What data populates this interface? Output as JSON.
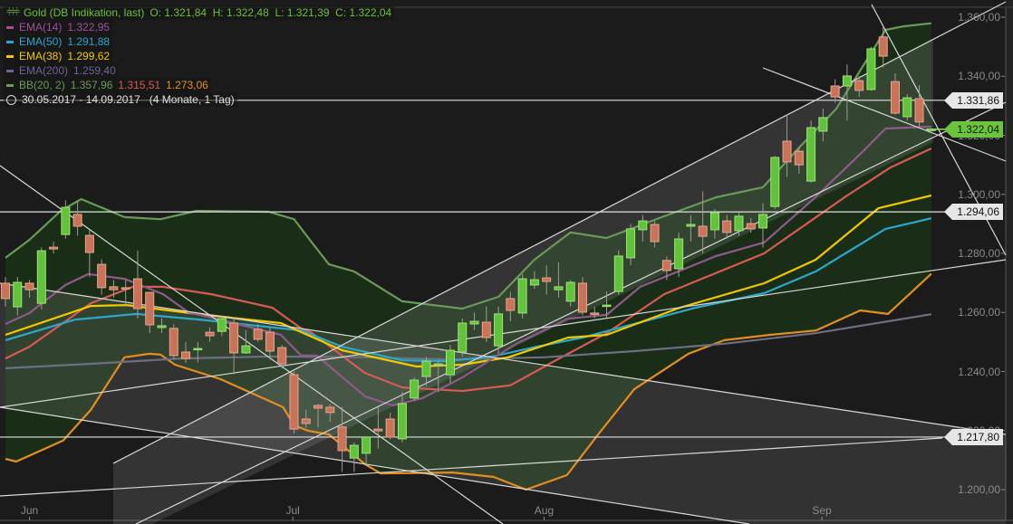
{
  "legend": {
    "title": "Gold (DB Indikation, last)",
    "ohlc": "O: 1.321,84  H: 1.322,48  L: 1.321,39  C: 1.322,04",
    "ema14": {
      "label": "EMA(14)",
      "value": "1.322,95",
      "color": "#a0509a"
    },
    "ema50": {
      "label": "EMA(50)",
      "value": "1.291,88",
      "color": "#2ba7cc"
    },
    "ema38": {
      "label": "EMA(38)",
      "value": "1.299,62",
      "color": "#f2c800"
    },
    "ema200": {
      "label": "EMA(200)",
      "value": "1.259,40",
      "color": "#6b6594"
    },
    "bb": {
      "label": "BB(20, 2)",
      "upper": "1.357,96",
      "mid": "1.315,51",
      "lower": "1.273,06",
      "upper_color": "#6a9a58",
      "mid_color": "#d85a55",
      "lower_color": "#e48e22"
    },
    "range": "30.05.2017 - 14.09.2017   (4 Monate, 1 Tag)",
    "title_color": "#6cbf3c"
  },
  "price_tags": [
    {
      "value": 1331.86,
      "label": "1.331,86",
      "type": "line"
    },
    {
      "value": 1322.04,
      "label": "1.322,04",
      "type": "last"
    },
    {
      "value": 1294.06,
      "label": "1.294,06",
      "type": "line"
    },
    {
      "value": 1217.8,
      "label": "1.217,80",
      "type": "line"
    }
  ],
  "chart_data": {
    "type": "candlestick",
    "title": "Gold (DB Indikation, last)",
    "ylim": [
      1200,
      1360
    ],
    "y_ticks": [
      {
        "value": 1360,
        "label": "1.360,00"
      },
      {
        "value": 1340,
        "label": "1.340,00"
      },
      {
        "value": 1320,
        "label": "1.320,00"
      },
      {
        "value": 1300,
        "label": "1.300,00"
      },
      {
        "value": 1280,
        "label": "1.280,00"
      },
      {
        "value": 1260,
        "label": "1.260,00"
      },
      {
        "value": 1240,
        "label": "1.240,00"
      },
      {
        "value": 1220,
        "label": "1.220,00"
      },
      {
        "value": 1200,
        "label": "1.200,00"
      }
    ],
    "x_ticks": [
      {
        "label": "Jun",
        "index": 2.0
      },
      {
        "label": "Jul",
        "index": 23.9
      },
      {
        "label": "Aug",
        "index": 44.8
      },
      {
        "label": "Sep",
        "index": 67.9
      }
    ],
    "candles_ohlc": [
      [
        1269.9,
        1272,
        1262,
        1264.7
      ],
      [
        1261.9,
        1272,
        1259,
        1270.2
      ],
      [
        1269.9,
        1271,
        1265,
        1267.7
      ],
      [
        1263.1,
        1282,
        1261,
        1280.9
      ],
      [
        1282.1,
        1284,
        1280,
        1281.5
      ],
      [
        1286.4,
        1298,
        1285,
        1295.6
      ],
      [
        1293.2,
        1298,
        1286,
        1289.2
      ],
      [
        1286.1,
        1288,
        1272,
        1280.3
      ],
      [
        1276.3,
        1278,
        1266,
        1268.4
      ],
      [
        1268.7,
        1271,
        1265,
        1267.7
      ],
      [
        1268.4,
        1271,
        1262,
        1268.0
      ],
      [
        1271.4,
        1281,
        1258,
        1261.3
      ],
      [
        1266.8,
        1267,
        1253,
        1255.8
      ],
      [
        1254.9,
        1258,
        1253,
        1255.5
      ],
      [
        1254.6,
        1256,
        1244,
        1245.4
      ],
      [
        1246.6,
        1250,
        1243,
        1244.4
      ],
      [
        1247.5,
        1250,
        1243,
        1247.8
      ],
      [
        1253.3,
        1255,
        1250,
        1252.1
      ],
      [
        1253.6,
        1259,
        1252,
        1257.9
      ],
      [
        1256.4,
        1258,
        1239,
        1246.3
      ],
      [
        1246.3,
        1254,
        1246,
        1248.7
      ],
      [
        1254.3,
        1256,
        1250,
        1250.9
      ],
      [
        1253.3,
        1255,
        1244,
        1246.9
      ],
      [
        1248.1,
        1249,
        1241,
        1242.6
      ],
      [
        1238.9,
        1240,
        1219,
        1220.5
      ],
      [
        1223.9,
        1227,
        1221,
        1222.4
      ],
      [
        1228.5,
        1229,
        1221,
        1227.6
      ],
      [
        1227.9,
        1229,
        1223,
        1226.1
      ],
      [
        1221.2,
        1228,
        1206,
        1213.2
      ],
      [
        1210.7,
        1216,
        1206,
        1215.0
      ],
      [
        1212.3,
        1218,
        1208,
        1217.8
      ],
      [
        1220.5,
        1228,
        1214,
        1219.9
      ],
      [
        1223.9,
        1226,
        1217,
        1217.8
      ],
      [
        1217.2,
        1233,
        1216,
        1229.1
      ],
      [
        1231.0,
        1238,
        1230,
        1237.1
      ],
      [
        1238.3,
        1245,
        1235,
        1243.5
      ],
      [
        1242.3,
        1244,
        1233,
        1242.6
      ],
      [
        1238.9,
        1249,
        1236,
        1247.2
      ],
      [
        1246.6,
        1258,
        1245,
        1256.4
      ],
      [
        1256.1,
        1260,
        1254,
        1257.0
      ],
      [
        1256.7,
        1262,
        1250,
        1251.5
      ],
      [
        1248.7,
        1262,
        1246,
        1259.5
      ],
      [
        1264.7,
        1267,
        1257,
        1260.7
      ],
      [
        1259.8,
        1273,
        1258,
        1271.4
      ],
      [
        1269.3,
        1274,
        1268,
        1271.1
      ],
      [
        1271.7,
        1276,
        1266,
        1270.5
      ],
      [
        1267.7,
        1277,
        1265,
        1268.7
      ],
      [
        1263.8,
        1271,
        1262,
        1270.2
      ],
      [
        1269.9,
        1272,
        1259,
        1260.1
      ],
      [
        1259.8,
        1262,
        1258,
        1259.5
      ],
      [
        1262.2,
        1267,
        1258,
        1262.5
      ],
      [
        1267.1,
        1281,
        1266,
        1279.1
      ],
      [
        1278.5,
        1290,
        1276,
        1288.3
      ],
      [
        1288.0,
        1293,
        1284,
        1291.0
      ],
      [
        1289.8,
        1291,
        1282,
        1284.0
      ],
      [
        1277.6,
        1279,
        1271,
        1274.2
      ],
      [
        1274.8,
        1287,
        1272,
        1284.9
      ],
      [
        1289.2,
        1293,
        1284,
        1289.8
      ],
      [
        1289.2,
        1301,
        1280,
        1285.8
      ],
      [
        1288.0,
        1295,
        1285,
        1293.8
      ],
      [
        1291.0,
        1293,
        1285,
        1287.1
      ],
      [
        1287.7,
        1294,
        1286,
        1292.6
      ],
      [
        1290.1,
        1292,
        1287,
        1288.3
      ],
      [
        1288.6,
        1297,
        1282,
        1293.2
      ],
      [
        1295.9,
        1313,
        1295,
        1312.5
      ],
      [
        1318.0,
        1327,
        1306,
        1311.0
      ],
      [
        1314.6,
        1316,
        1307,
        1310.0
      ],
      [
        1304.5,
        1325,
        1304,
        1322.6
      ],
      [
        1321.4,
        1329,
        1318,
        1326.0
      ],
      [
        1336.7,
        1339,
        1331,
        1333.0
      ],
      [
        1336.7,
        1344,
        1325,
        1340.1
      ],
      [
        1338.5,
        1340,
        1333,
        1335.2
      ],
      [
        1335.5,
        1350,
        1335,
        1349.3
      ],
      [
        1353.3,
        1357,
        1343,
        1346.8
      ],
      [
        1338.2,
        1341,
        1327,
        1327.5
      ],
      [
        1326.3,
        1334,
        1325,
        1332.7
      ],
      [
        1332.4,
        1337,
        1323,
        1324.5
      ],
      [
        1321.84,
        1322.48,
        1321.39,
        1322.04
      ]
    ],
    "series": [
      {
        "name": "BB upper",
        "color": "#6a9a58",
        "points": [
          [
            0,
            1278.5
          ],
          [
            2,
            1284.6
          ],
          [
            4.6,
            1294.4
          ],
          [
            6.3,
            1298.4
          ],
          [
            9.9,
            1292.3
          ],
          [
            12.9,
            1291.6
          ],
          [
            15.9,
            1294.4
          ],
          [
            21.9,
            1294.1
          ],
          [
            24,
            1291.6
          ],
          [
            25.2,
            1285.2
          ],
          [
            26.9,
            1276.3
          ],
          [
            29,
            1273.9
          ],
          [
            33,
            1263.8
          ],
          [
            38,
            1261.3
          ],
          [
            41,
            1265.3
          ],
          [
            44,
            1277.9
          ],
          [
            47,
            1287.1
          ],
          [
            50,
            1285.2
          ],
          [
            54.6,
            1292.3
          ],
          [
            59.1,
            1299.0
          ],
          [
            63,
            1302.4
          ],
          [
            66.1,
            1316.2
          ],
          [
            69.1,
            1329.0
          ],
          [
            73.2,
            1355.7
          ],
          [
            74.7,
            1356.9
          ],
          [
            77,
            1357.96
          ]
        ]
      },
      {
        "name": "BB lower",
        "color": "#e48e22",
        "points": [
          [
            0,
            1210.4
          ],
          [
            0.9,
            1209.5
          ],
          [
            4.8,
            1216.6
          ],
          [
            7.1,
            1227.0
          ],
          [
            9.9,
            1244.8
          ],
          [
            12,
            1246.0
          ],
          [
            12.9,
            1245.7
          ],
          [
            14.1,
            1242.3
          ],
          [
            17.9,
            1237.4
          ],
          [
            20.9,
            1231.9
          ],
          [
            23.1,
            1227.9
          ],
          [
            24,
            1221.8
          ],
          [
            25.2,
            1219.9
          ],
          [
            26.9,
            1218.7
          ],
          [
            29.9,
            1208.6
          ],
          [
            31.2,
            1205.5
          ],
          [
            37.2,
            1205.8
          ],
          [
            40.6,
            1204.3
          ],
          [
            43.3,
            1200.0
          ],
          [
            46.7,
            1204.9
          ],
          [
            49.3,
            1218.7
          ],
          [
            52.3,
            1234.0
          ],
          [
            56.8,
            1246.0
          ],
          [
            59.8,
            1250.6
          ],
          [
            63.6,
            1252.4
          ],
          [
            67.4,
            1253.9
          ],
          [
            71.1,
            1260.7
          ],
          [
            73.4,
            1259.5
          ],
          [
            77,
            1273.06
          ]
        ]
      },
      {
        "name": "BB mid",
        "color": "#d85a55",
        "points": [
          [
            0,
            1244.4
          ],
          [
            2,
            1248.4
          ],
          [
            7.1,
            1263.1
          ],
          [
            10.6,
            1268.7
          ],
          [
            13.1,
            1268.7
          ],
          [
            17.1,
            1266.2
          ],
          [
            22.2,
            1261.6
          ],
          [
            24.6,
            1254.6
          ],
          [
            25.4,
            1253.3
          ],
          [
            29.9,
            1239.5
          ],
          [
            33,
            1234.6
          ],
          [
            38,
            1233.4
          ],
          [
            42,
            1235.3
          ],
          [
            45.5,
            1243.2
          ],
          [
            50,
            1253.0
          ],
          [
            54.8,
            1266.2
          ],
          [
            63.1,
            1280.0
          ],
          [
            69.9,
            1299.3
          ],
          [
            73.6,
            1309.1
          ],
          [
            77,
            1315.51
          ]
        ]
      },
      {
        "name": "EMA(200)",
        "color": "#6b6f80",
        "points": [
          [
            0,
            1241.1
          ],
          [
            7.1,
            1242.6
          ],
          [
            14.6,
            1244.4
          ],
          [
            22.2,
            1245.1
          ],
          [
            29.7,
            1244.8
          ],
          [
            37.2,
            1244.1
          ],
          [
            44.8,
            1244.8
          ],
          [
            52.3,
            1246.9
          ],
          [
            59.8,
            1249.4
          ],
          [
            67.4,
            1253.0
          ],
          [
            77,
            1259.4
          ]
        ]
      },
      {
        "name": "EMA(50)",
        "color": "#2ba7cc",
        "points": [
          [
            0,
            1250.6
          ],
          [
            5.8,
            1257.6
          ],
          [
            10.9,
            1259.5
          ],
          [
            16.1,
            1257.6
          ],
          [
            24.6,
            1253.9
          ],
          [
            28,
            1248.4
          ],
          [
            33,
            1243.8
          ],
          [
            36.7,
            1243.5
          ],
          [
            40.5,
            1245.1
          ],
          [
            44.2,
            1248.4
          ],
          [
            48,
            1251.5
          ],
          [
            57.4,
            1261.6
          ],
          [
            63.1,
            1266.5
          ],
          [
            67.4,
            1273.9
          ],
          [
            73.2,
            1288.3
          ],
          [
            77,
            1291.88
          ]
        ]
      },
      {
        "name": "EMA(38)",
        "color": "#f2c800",
        "points": [
          [
            0,
            1252.4
          ],
          [
            7.1,
            1262.2
          ],
          [
            10.1,
            1262.5
          ],
          [
            15.9,
            1259.5
          ],
          [
            22.9,
            1256.4
          ],
          [
            28,
            1247.2
          ],
          [
            34.2,
            1241.7
          ],
          [
            38,
            1242.3
          ],
          [
            41.8,
            1244.8
          ],
          [
            46.8,
            1251.5
          ],
          [
            50,
            1252.4
          ],
          [
            56.1,
            1261.6
          ],
          [
            63.1,
            1269.9
          ],
          [
            67.4,
            1277.9
          ],
          [
            72.6,
            1295.3
          ],
          [
            77,
            1299.62
          ]
        ]
      },
      {
        "name": "EMA(14)",
        "color": "#8e5a8c",
        "points": [
          [
            0,
            1256.1
          ],
          [
            2,
            1259.8
          ],
          [
            5,
            1269.3
          ],
          [
            6.9,
            1273.0
          ],
          [
            9.9,
            1271.4
          ],
          [
            13.1,
            1266.2
          ],
          [
            15.2,
            1260.1
          ],
          [
            18.4,
            1257.0
          ],
          [
            22.9,
            1252.4
          ],
          [
            24.6,
            1245.4
          ],
          [
            25.9,
            1245.4
          ],
          [
            29.9,
            1231.6
          ],
          [
            32.2,
            1228.5
          ],
          [
            34.7,
            1231.0
          ],
          [
            38,
            1238.0
          ],
          [
            42.5,
            1249.4
          ],
          [
            46.8,
            1257.9
          ],
          [
            50,
            1259.2
          ],
          [
            52.8,
            1268.7
          ],
          [
            59.1,
            1279.1
          ],
          [
            63.1,
            1283.7
          ],
          [
            67.2,
            1298.4
          ],
          [
            71.1,
            1313.7
          ],
          [
            73.2,
            1322.3
          ],
          [
            77,
            1322.95
          ]
        ]
      }
    ],
    "up_color": "#63c23c",
    "down_color": "#c8735a"
  }
}
